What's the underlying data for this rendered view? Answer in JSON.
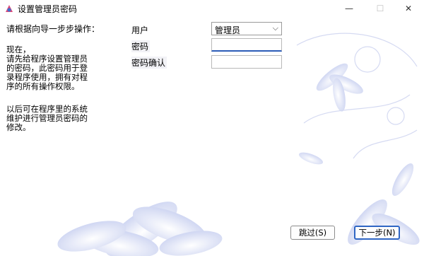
{
  "window": {
    "title": "设置管理员密码",
    "minimize_glyph": "—",
    "maximize_glyph": "☐",
    "close_glyph": "✕"
  },
  "intro": {
    "heading": "请根据向导一步步操作：",
    "paragraph1": "现在，\n请先给程序设置管理员的密码，此密码用于登录程序使用，拥有对程序的所有操作权限。",
    "paragraph2": "以后可在程序里的系统维护进行管理员密码的修改。"
  },
  "form": {
    "user_label": "用户",
    "user_value": "管理员",
    "password_label": "密码",
    "password_value": "",
    "confirm_label": "密码确认",
    "confirm_value": ""
  },
  "buttons": {
    "skip": "跳过(S)",
    "next": "下一步(N)"
  },
  "icons": {
    "app": "app-icon",
    "dropdown": "chevron-down-icon"
  },
  "colors": {
    "accent": "#2f66c4",
    "flower": "#c9d1f0"
  }
}
